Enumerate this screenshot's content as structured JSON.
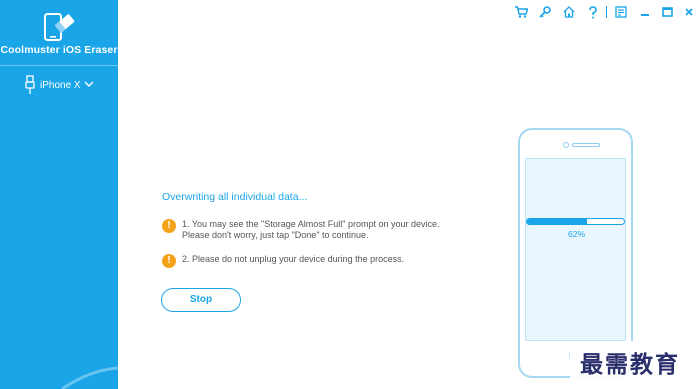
{
  "app": {
    "title": "Coolmuster iOS Eraser",
    "device": "iPhone X"
  },
  "toolbar": {
    "icons": [
      "cart-icon",
      "key-icon",
      "home-icon",
      "help-icon",
      "feedback-icon",
      "minimize-icon",
      "maximize-icon",
      "close-icon"
    ]
  },
  "main": {
    "status_title": "Overwriting all individual data...",
    "note1": "1. You may see the \"Storage Almost Full\" prompt on your device.",
    "note1_line2": "Please don't worry, just tap \"Done\" to continue.",
    "note2": "2. Please do not unplug your device during the process.",
    "warn_glyph": "!",
    "stop_label": "Stop"
  },
  "phone": {
    "progress_text": "62%",
    "progress_value": 0.62
  },
  "watermark": {
    "text": "最需教育"
  },
  "colors": {
    "accent": "#1aa5e8",
    "warning": "#f4a21a"
  }
}
